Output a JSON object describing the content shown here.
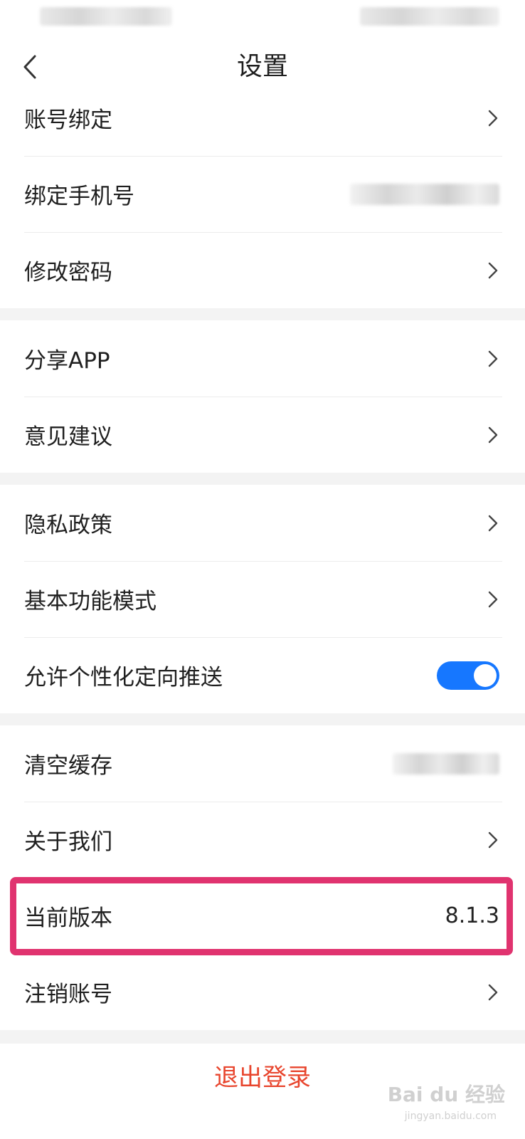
{
  "nav": {
    "title": "设置",
    "back_icon": "chevron-left-icon"
  },
  "sections": {
    "account": {
      "bind_account": "账号绑定",
      "bind_phone": "绑定手机号",
      "change_password": "修改密码"
    },
    "share": {
      "share_app": "分享APP",
      "feedback": "意见建议"
    },
    "privacy": {
      "privacy_policy": "隐私政策",
      "basic_mode": "基本功能模式",
      "personalized_push": "允许个性化定向推送",
      "personalized_push_enabled": true
    },
    "misc": {
      "clear_cache": "清空缓存",
      "about_us": "关于我们",
      "current_version": "当前版本",
      "version_value": "8.1.3",
      "deactivate_account": "注销账号"
    }
  },
  "logout": {
    "label": "退出登录"
  },
  "watermark": {
    "brand": "Bai du 经验",
    "url": "jingyan.baidu.com"
  },
  "colors": {
    "accent": "#1677ff",
    "logout": "#e8452d",
    "highlight": "#e0336f",
    "background": "#f3f3f3"
  }
}
